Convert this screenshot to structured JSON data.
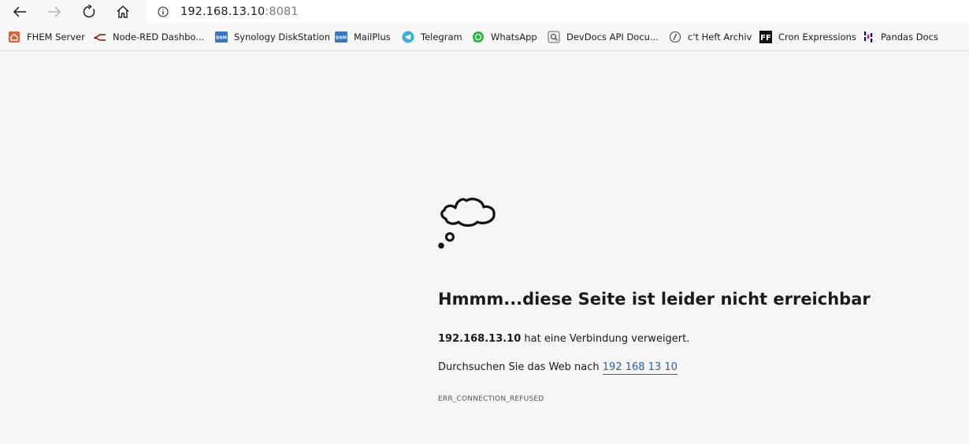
{
  "browser": {
    "address": {
      "host": "192.168.13.10",
      "port": ":8081"
    },
    "bookmarks": [
      {
        "label": "FHEM Server",
        "icon": "fhem-icon"
      },
      {
        "label": "Node-RED Dashbo...",
        "icon": "node-red-icon"
      },
      {
        "label": "Synology DiskStation",
        "icon": "dsm-icon"
      },
      {
        "label": "MailPlus",
        "icon": "dsm-icon"
      },
      {
        "label": "Telegram",
        "icon": "telegram-icon"
      },
      {
        "label": "WhatsApp",
        "icon": "whatsapp-icon"
      },
      {
        "label": "DevDocs API Docu...",
        "icon": "devdocs-icon"
      },
      {
        "label": "c't Heft Archiv",
        "icon": "ct-icon"
      },
      {
        "label": "Cron Expressions",
        "icon": "ff-icon"
      },
      {
        "label": "Pandas Docs",
        "icon": "pandas-icon"
      }
    ],
    "bookmark_icon_text": {
      "dsm": "DSM",
      "ff": "FF"
    }
  },
  "error_page": {
    "headline": "Hmmm...diese Seite ist leider nicht erreichbar",
    "host_bold": "192.168.13.10",
    "refused_text": " hat eine Verbindung verweigert.",
    "search_prefix": "Durchsuchen Sie das Web nach ",
    "search_link": "192 168 13 10",
    "error_code": "ERR_CONNECTION_REFUSED"
  }
}
